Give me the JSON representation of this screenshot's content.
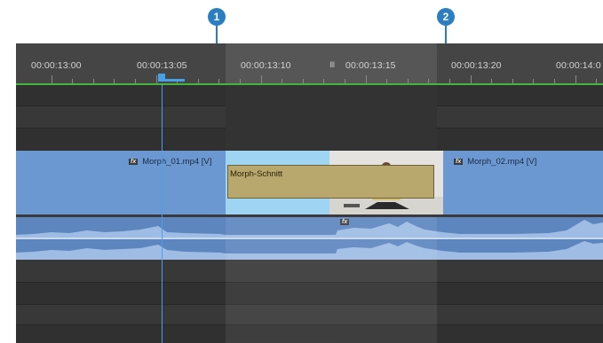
{
  "callouts": [
    "1",
    "2"
  ],
  "ruler": {
    "timecodes": [
      "00:00:13:00",
      "00:00:13:05",
      "00:00:13:10",
      "00:00:13:15",
      "00:00:13:20",
      "00:00:14:0"
    ],
    "marker_glyph": "Ⅲ"
  },
  "video_track": {
    "clip_a": {
      "fx": "fx",
      "label": "Morph_01.mp4 [V]"
    },
    "transition": {
      "label": "Morph-Schnitt"
    },
    "clip_b": {
      "fx": "fx",
      "label": "Morph_02.mp4 [V]"
    }
  },
  "audio_track": {
    "fx": "fx"
  },
  "colors": {
    "accent": "#2b7fc0",
    "playhead": "#4aa0e6",
    "work_area": "#44b53c",
    "video_clip": "#6c98d2",
    "transition": "#9fd5f2",
    "audio_clip": "#5d86bf"
  }
}
